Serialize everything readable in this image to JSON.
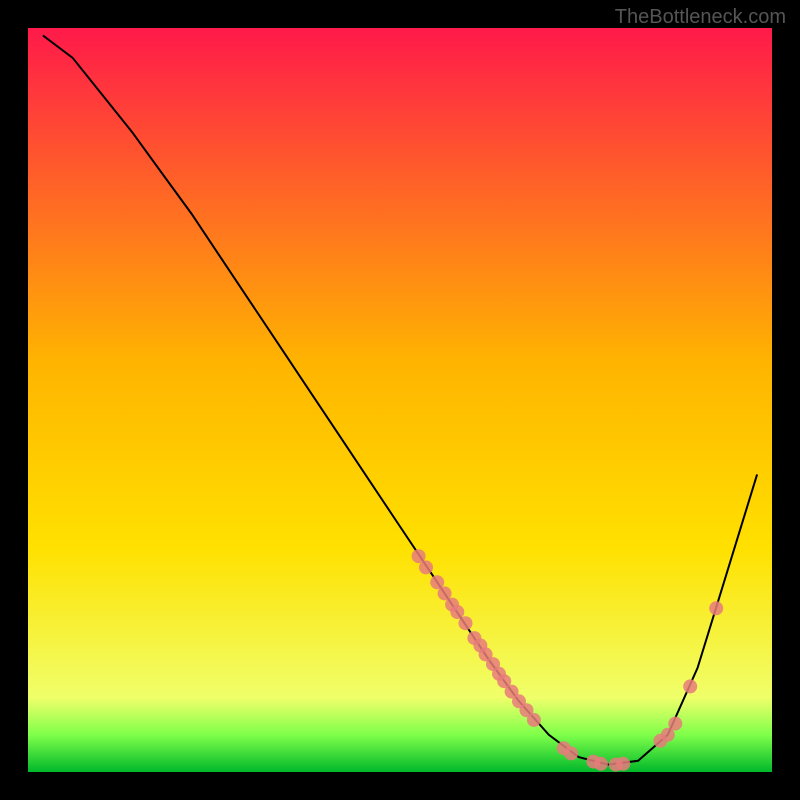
{
  "watermark": "TheBottleneck.com",
  "chart_data": {
    "type": "line",
    "title": "",
    "xlabel": "",
    "ylabel": "",
    "xlim": [
      0,
      100
    ],
    "ylim": [
      0,
      100
    ],
    "gradient": {
      "top": "#ff1a4a",
      "mid": "#ffd400",
      "low": "#f8ff66",
      "green": "#2eea4f",
      "bottom": "#00b82a"
    },
    "curve": [
      {
        "x": 2,
        "y": 99
      },
      {
        "x": 6,
        "y": 96
      },
      {
        "x": 10,
        "y": 91
      },
      {
        "x": 14,
        "y": 86
      },
      {
        "x": 18,
        "y": 80.5
      },
      {
        "x": 22,
        "y": 75
      },
      {
        "x": 26,
        "y": 69
      },
      {
        "x": 30,
        "y": 63
      },
      {
        "x": 34,
        "y": 57
      },
      {
        "x": 38,
        "y": 51
      },
      {
        "x": 42,
        "y": 45
      },
      {
        "x": 46,
        "y": 39
      },
      {
        "x": 50,
        "y": 33
      },
      {
        "x": 54,
        "y": 27
      },
      {
        "x": 58,
        "y": 21
      },
      {
        "x": 62,
        "y": 15
      },
      {
        "x": 66,
        "y": 9.5
      },
      {
        "x": 70,
        "y": 5
      },
      {
        "x": 74,
        "y": 2
      },
      {
        "x": 78,
        "y": 1
      },
      {
        "x": 82,
        "y": 1.5
      },
      {
        "x": 86,
        "y": 5
      },
      {
        "x": 90,
        "y": 14
      },
      {
        "x": 94,
        "y": 27
      },
      {
        "x": 98,
        "y": 40
      }
    ],
    "markers": [
      {
        "x": 52.5,
        "y": 29
      },
      {
        "x": 53.5,
        "y": 27.5
      },
      {
        "x": 55,
        "y": 25.5
      },
      {
        "x": 56,
        "y": 24
      },
      {
        "x": 57,
        "y": 22.5
      },
      {
        "x": 57.7,
        "y": 21.5
      },
      {
        "x": 58.8,
        "y": 20
      },
      {
        "x": 60,
        "y": 18
      },
      {
        "x": 60.8,
        "y": 17
      },
      {
        "x": 61.5,
        "y": 15.8
      },
      {
        "x": 62.5,
        "y": 14.5
      },
      {
        "x": 63.3,
        "y": 13.2
      },
      {
        "x": 64,
        "y": 12.2
      },
      {
        "x": 65,
        "y": 10.8
      },
      {
        "x": 66,
        "y": 9.5
      },
      {
        "x": 67,
        "y": 8.3
      },
      {
        "x": 68,
        "y": 7
      },
      {
        "x": 72,
        "y": 3.2
      },
      {
        "x": 73,
        "y": 2.5
      },
      {
        "x": 76,
        "y": 1.4
      },
      {
        "x": 77,
        "y": 1.1
      },
      {
        "x": 79,
        "y": 1
      },
      {
        "x": 80,
        "y": 1.1
      },
      {
        "x": 85,
        "y": 4.2
      },
      {
        "x": 86,
        "y": 5
      },
      {
        "x": 87,
        "y": 6.5
      },
      {
        "x": 89,
        "y": 11.5
      },
      {
        "x": 92.5,
        "y": 22
      }
    ]
  }
}
